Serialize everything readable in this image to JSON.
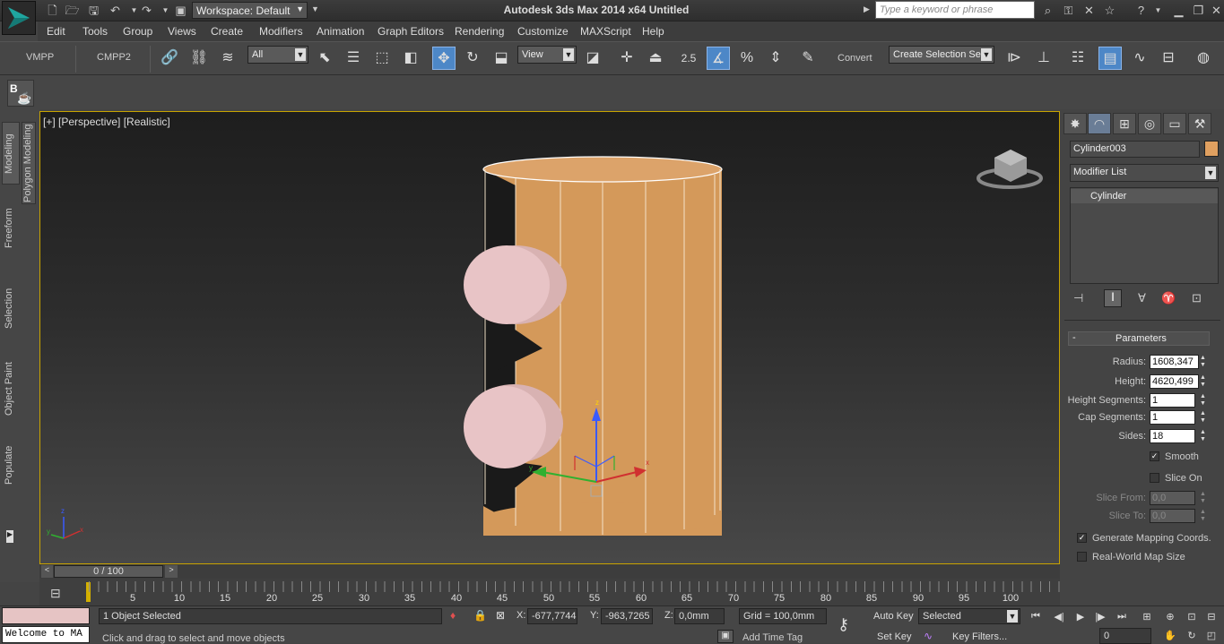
{
  "titlebar": {
    "workspace": "Workspace: Default",
    "title": "Autodesk 3ds Max  2014 x64      Untitled",
    "search_placeholder": "Type a keyword or phrase"
  },
  "menu": [
    "Edit",
    "Tools",
    "Group",
    "Views",
    "Create",
    "Modifiers",
    "Animation",
    "Graph Editors",
    "Rendering",
    "Customize",
    "MAXScript",
    "Help"
  ],
  "toolbar": {
    "tab_vmpp": "VMPP",
    "tab_cmpp2": "CMPP2",
    "selection_filter": "All",
    "ref_coord": "View",
    "snap_angle": "2.5",
    "snap_percent": "%",
    "convert": "Convert",
    "named_selection": "Create Selection Se"
  },
  "ribbon": {
    "button": "B"
  },
  "left_tabs": [
    "Modeling",
    "Polygon Modeling",
    "Freeform",
    "Selection",
    "Object Paint",
    "Populate"
  ],
  "viewport": {
    "label": "[+] [Perspective] [Realistic]",
    "axis_x": "x",
    "axis_y": "y",
    "axis_z": "z"
  },
  "cmdpanel": {
    "object_name": "Cylinder003",
    "object_color": "#e0a060",
    "modifier_list": "Modifier List",
    "stack_item": "Cylinder",
    "rollout_title": "Parameters",
    "rollout_toggle": "-",
    "params": [
      {
        "label": "Radius:",
        "value": "1608,347"
      },
      {
        "label": "Height:",
        "value": "4620,499"
      },
      {
        "label": "Height Segments:",
        "value": "1"
      },
      {
        "label": "Cap Segments:",
        "value": "1"
      },
      {
        "label": "Sides:",
        "value": "18"
      }
    ],
    "smooth": "Smooth",
    "slice_on": "Slice On",
    "slice_from_label": "Slice From:",
    "slice_from": "0,0",
    "slice_to_label": "Slice To:",
    "slice_to": "0,0",
    "gen_mapping": "Generate Mapping Coords.",
    "real_world": "Real-World Map Size"
  },
  "timeline": {
    "frame": "0 / 100",
    "ticks": [
      "5",
      "10",
      "15",
      "20",
      "25",
      "30",
      "35",
      "40",
      "45",
      "50",
      "55",
      "60",
      "65",
      "70",
      "75",
      "80",
      "85",
      "90",
      "95",
      "100"
    ]
  },
  "status": {
    "maxscript": "Welcome to MA",
    "selected": "1 Object Selected",
    "prompt": "Click and drag to select and move objects",
    "x_label": "X:",
    "x": "-677,7744",
    "y_label": "Y:",
    "y": "-963,7265",
    "z_label": "Z:",
    "z": "0,0mm",
    "grid": "Grid = 100,0mm",
    "add_time_tag": "Add Time Tag",
    "auto_key": "Auto Key",
    "set_key": "Set Key",
    "key_mode": "Selected",
    "key_filters": "Key Filters...",
    "frame_field": "0"
  }
}
